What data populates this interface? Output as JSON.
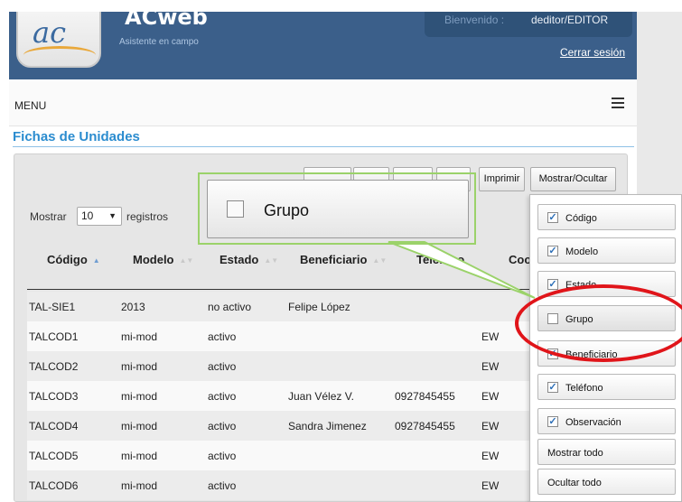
{
  "header": {
    "logo_text": "ac",
    "app_name": "ACweb",
    "app_subtitle": "Asistente en campo",
    "welcome_text": "Bienvenido :",
    "username": "deditor/EDITOR",
    "logout_label": "Cerrar sesión"
  },
  "menu": {
    "label": "MENU"
  },
  "page_title": "Fichas de Unidades",
  "toolbar": {
    "print_label": "Imprimir",
    "toggle_label": "Mostrar/Ocultar"
  },
  "length": {
    "prefix": "Mostrar",
    "value": "10",
    "suffix": "registros"
  },
  "table": {
    "headers": [
      "Código",
      "Modelo",
      "Estado",
      "Beneficiario",
      "Teléfono",
      "Coor"
    ],
    "rows": [
      [
        "TAL-SIE1",
        "2013",
        "no activo",
        "Felipe López",
        "",
        ""
      ],
      [
        "TALCOD1",
        "mi-mod",
        "activo",
        "",
        "",
        "EW"
      ],
      [
        "TALCOD2",
        "mi-mod",
        "activo",
        "",
        "",
        "EW"
      ],
      [
        "TALCOD3",
        "mi-mod",
        "activo",
        "Juan Vélez V.",
        "0927845455",
        "EW"
      ],
      [
        "TALCOD4",
        "mi-mod",
        "activo",
        "Sandra Jimenez",
        "0927845455",
        "EW"
      ],
      [
        "TALCOD5",
        "mi-mod",
        "activo",
        "",
        "",
        "EW"
      ],
      [
        "TALCOD6",
        "mi-mod",
        "activo",
        "",
        "",
        "EW"
      ]
    ]
  },
  "column_menu": {
    "items": [
      {
        "label": "Código",
        "checked": true
      },
      {
        "label": "Modelo",
        "checked": true
      },
      {
        "label": "Estado",
        "checked": true
      },
      {
        "label": "Grupo",
        "checked": false
      },
      {
        "label": "Beneficiario",
        "checked": true
      },
      {
        "label": "Teléfono",
        "checked": true
      },
      {
        "label": "Observación",
        "checked": true
      }
    ],
    "show_all_label": "Mostrar todo",
    "hide_all_label": "Ocultar todo"
  },
  "callout": {
    "label": "Grupo",
    "checked": false
  },
  "colors": {
    "header_bg": "#3b5f8a",
    "title": "#2b8ccf",
    "callout_border": "#9bd26a",
    "highlight_ring": "#e0151a"
  }
}
